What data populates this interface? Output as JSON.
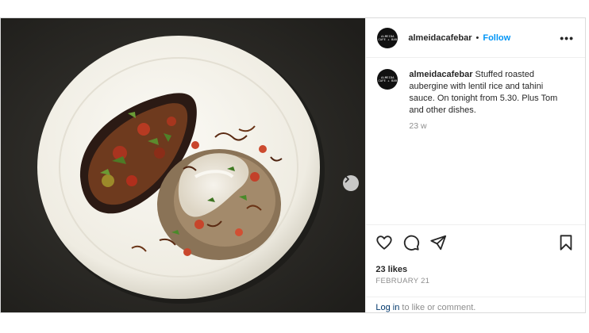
{
  "account": {
    "username": "almeidacafebar",
    "avatar_text_1": "ALMEIDA",
    "avatar_text_2": "CAFE + BAR"
  },
  "header": {
    "separator": "•",
    "follow_label": "Follow",
    "more_label": "•••"
  },
  "caption": {
    "text": "Stuffed roasted aubergine with lentil rice and tahini sauce. On tonight from 5.30. Plus Tom and other dishes.",
    "age": "23 w"
  },
  "engagement": {
    "likes": "23 likes",
    "date": "FEBRUARY 21"
  },
  "footer": {
    "login_link": "Log in",
    "login_rest": " to like or comment."
  },
  "carousel": {
    "slide_count": 2,
    "active_index": 0
  },
  "colors": {
    "follow_blue": "#0095f6",
    "link_dark_blue": "#00376b",
    "muted_gray": "#8e8e8e"
  },
  "icons": [
    "heart-icon",
    "comment-icon",
    "share-icon",
    "bookmark-icon",
    "chevron-right-icon",
    "more-icon"
  ]
}
